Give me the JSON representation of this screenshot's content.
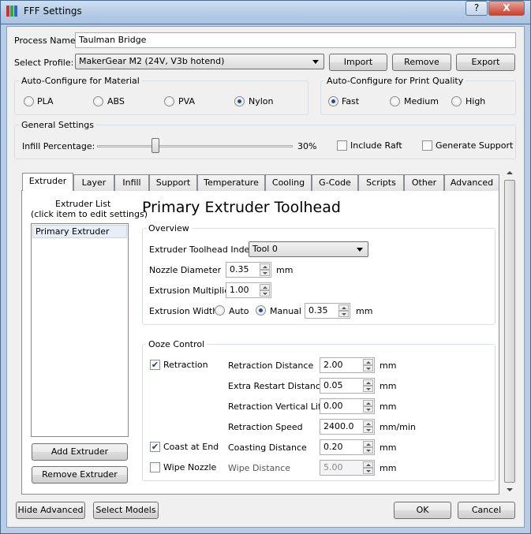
{
  "window": {
    "title": "FFF Settings",
    "help": "?",
    "close": "X"
  },
  "process": {
    "label": "Process Name:",
    "value": "Taulman Bridge"
  },
  "profile": {
    "label": "Select Profile:",
    "value": "MakerGear M2 (24V, V3b hotend)",
    "import": "Import",
    "remove": "Remove",
    "export": "Export"
  },
  "material": {
    "title": "Auto-Configure for Material",
    "options": [
      "PLA",
      "ABS",
      "PVA",
      "Nylon"
    ],
    "selected": "Nylon"
  },
  "quality": {
    "title": "Auto-Configure for Print Quality",
    "options": [
      "Fast",
      "Medium",
      "High"
    ],
    "selected": "Fast"
  },
  "general": {
    "title": "General Settings",
    "infill_label": "Infill Percentage:",
    "infill_value": "30%",
    "infill_fraction": 0.3,
    "include_raft": "Include Raft",
    "generate_support": "Generate Support"
  },
  "tabs": [
    "Extruder",
    "Layer",
    "Infill",
    "Support",
    "Temperature",
    "Cooling",
    "G-Code",
    "Scripts",
    "Other",
    "Advanced"
  ],
  "extruder_list": {
    "title_line1": "Extruder List",
    "title_line2": "(click item to edit settings)",
    "items": [
      "Primary Extruder"
    ],
    "add": "Add Extruder",
    "remove": "Remove Extruder"
  },
  "heading": "Primary Extruder Toolhead",
  "overview": {
    "title": "Overview",
    "toolhead_label": "Extruder Toolhead Index",
    "toolhead_value": "Tool 0",
    "nozzle_label": "Nozzle Diameter",
    "nozzle_value": "0.35",
    "nozzle_unit": "mm",
    "multiplier_label": "Extrusion Multiplier",
    "multiplier_value": "1.00",
    "width_label": "Extrusion Width",
    "width_auto": "Auto",
    "width_manual": "Manual",
    "width_value": "0.35",
    "width_unit": "mm"
  },
  "ooze": {
    "title": "Ooze Control",
    "retraction": "Retraction",
    "coast": "Coast at End",
    "wipe": "Wipe Nozzle",
    "rows": [
      {
        "label": "Retraction Distance",
        "value": "2.00",
        "unit": "mm"
      },
      {
        "label": "Extra Restart Distance",
        "value": "0.05",
        "unit": "mm"
      },
      {
        "label": "Retraction Vertical Lift",
        "value": "0.00",
        "unit": "mm"
      },
      {
        "label": "Retraction Speed",
        "value": "2400.0",
        "unit": "mm/min"
      },
      {
        "label": "Coasting Distance",
        "value": "0.20",
        "unit": "mm"
      },
      {
        "label": "Wipe Distance",
        "value": "5.00",
        "unit": "mm"
      }
    ]
  },
  "footer": {
    "hide_advanced": "Hide Advanced",
    "select_models": "Select Models",
    "ok": "OK",
    "cancel": "Cancel"
  }
}
